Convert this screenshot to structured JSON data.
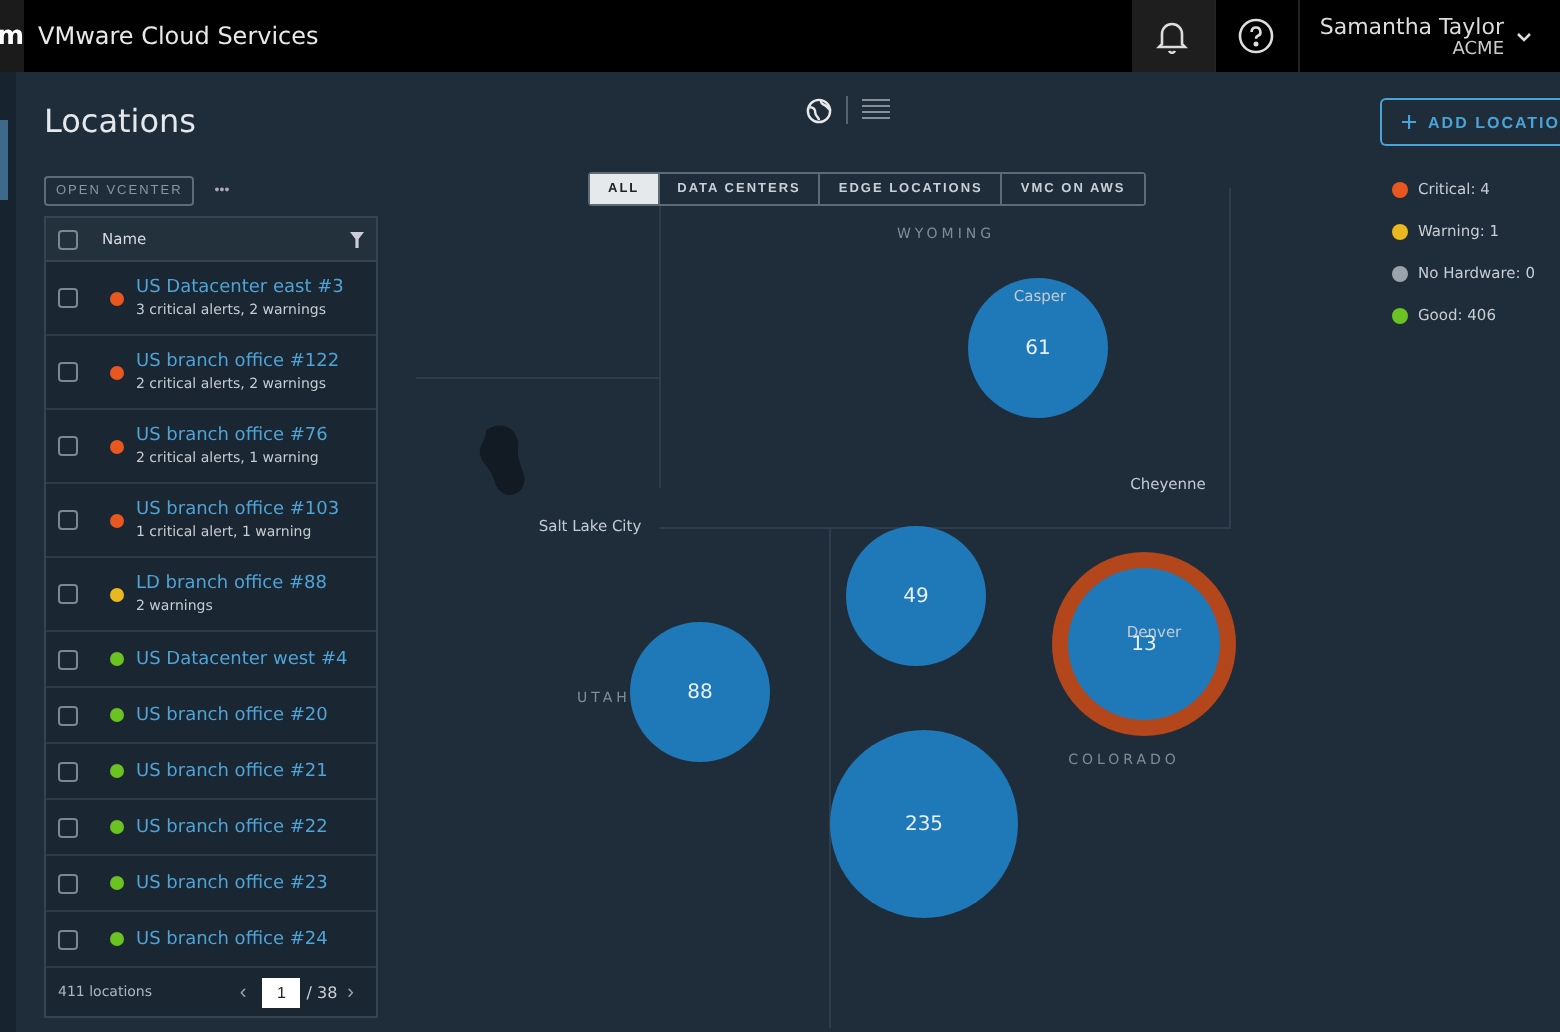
{
  "header": {
    "logo": "m",
    "title": "VMware Cloud Services",
    "user": {
      "name": "Samantha Taylor",
      "org": "ACME"
    }
  },
  "page": {
    "title": "Locations",
    "open_button": "OPEN VCENTER",
    "more": "•••",
    "add_button": "ADD LOCATIO"
  },
  "view_toggle": [
    {
      "kind": "map",
      "selected": true
    },
    {
      "kind": "list",
      "selected": false
    }
  ],
  "filters": [
    {
      "label": "ALL",
      "selected": true
    },
    {
      "label": "DATA CENTERS",
      "selected": false
    },
    {
      "label": "EDGE LOCATIONS",
      "selected": false
    },
    {
      "label": "VMC ON AWS",
      "selected": false
    }
  ],
  "table": {
    "column": "Name",
    "all_checked": false,
    "rows": [
      {
        "name": "US Datacenter east #3",
        "detail": "3 critical alerts, 2 warnings",
        "color": "#e8571f",
        "checked": false
      },
      {
        "name": "US branch office #122",
        "detail": "2 critical alerts, 2 warnings",
        "color": "#e8571f",
        "checked": false
      },
      {
        "name": "US branch office #76",
        "detail": "2 critical alerts, 1 warning",
        "color": "#e8571f",
        "checked": false
      },
      {
        "name": "US branch office #103",
        "detail": "1 critical alert, 1 warning",
        "color": "#e8571f",
        "checked": false
      },
      {
        "name": "LD branch office #88",
        "detail": "2 warnings",
        "color": "#e9b820",
        "checked": false
      },
      {
        "name": "US Datacenter west #4",
        "color": "#6cc123",
        "checked": false
      },
      {
        "name": "US branch office #20",
        "color": "#6cc123",
        "checked": false
      },
      {
        "name": "US branch office #21",
        "color": "#6cc123",
        "checked": false
      },
      {
        "name": "US branch office #22",
        "color": "#6cc123",
        "checked": false
      },
      {
        "name": "US branch office #23",
        "color": "#6cc123",
        "checked": false
      },
      {
        "name": "US branch office #24",
        "color": "#6cc123",
        "checked": false
      }
    ],
    "footer": {
      "count": "411 locations",
      "prev": "‹",
      "page": "1",
      "total": "/ 38",
      "next": "›"
    }
  },
  "legend": [
    {
      "label": "Critical: 4",
      "color": "#e8571f"
    },
    {
      "label": "Warning: 1",
      "color": "#e9b820"
    },
    {
      "label": "No Hardware: 0",
      "color": "#9aa3ab"
    },
    {
      "label": "Good: 406",
      "color": "#6cc123"
    }
  ],
  "map": {
    "labels": [
      {
        "text": "WYOMING",
        "kind": "state"
      },
      {
        "text": "Casper",
        "kind": "city"
      },
      {
        "text": "Cheyenne",
        "kind": "city"
      },
      {
        "text": "Salt Lake City",
        "kind": "city"
      },
      {
        "text": "UTAH",
        "kind": "state"
      },
      {
        "text": "Denver",
        "kind": "city"
      },
      {
        "text": "COLORADO",
        "kind": "state"
      }
    ],
    "clusters": [
      {
        "count": "61",
        "critical": false
      },
      {
        "count": "49",
        "critical": false
      },
      {
        "count": "88",
        "critical": false
      },
      {
        "count": "235",
        "critical": false
      },
      {
        "count": "13",
        "critical": true
      }
    ]
  }
}
